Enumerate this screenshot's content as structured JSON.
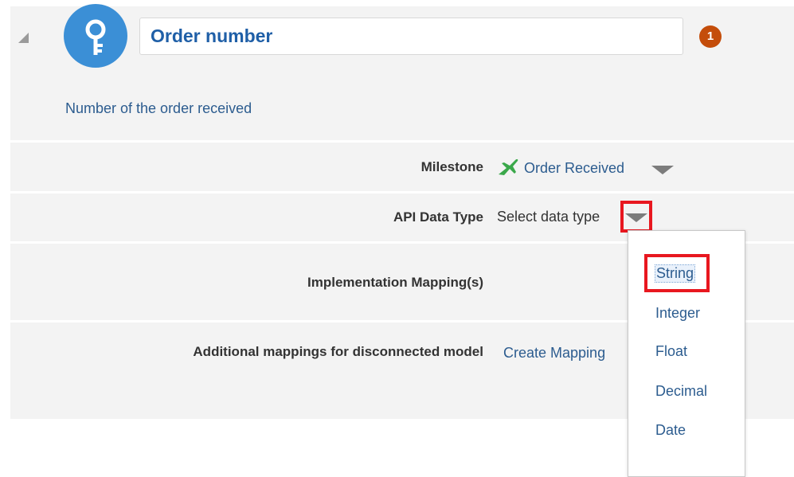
{
  "header": {
    "name_value": "Order number",
    "badge_count": "1",
    "icon": "key-icon",
    "description": "Number of the order received"
  },
  "rows": {
    "milestone": {
      "label": "Milestone",
      "value": "Order Received",
      "icon": "milestone-plane-icon"
    },
    "api_data_type": {
      "label": "API Data Type",
      "value": "Select data type"
    },
    "implementation_mapping": {
      "label": "Implementation Mapping(s)"
    },
    "additional_mappings": {
      "label": "Additional mappings for disconnected model",
      "action": "Create Mapping"
    }
  },
  "data_type_options": [
    "String",
    "Integer",
    "Float",
    "Decimal",
    "Date"
  ],
  "highlighted_option": "String",
  "colors": {
    "accent_blue": "#3b8fd6",
    "link_blue": "#2c5c8f",
    "badge_orange": "#c44d0a",
    "highlight_red": "#e8171f",
    "milestone_green": "#3aa84a"
  }
}
